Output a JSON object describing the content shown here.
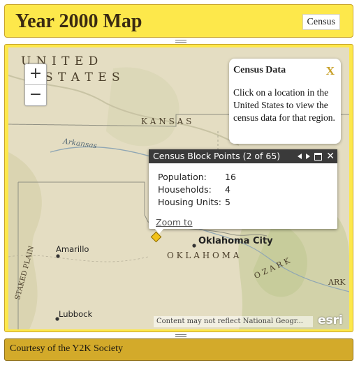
{
  "header": {
    "title": "Year 2000 Map",
    "census_button": "Census"
  },
  "map": {
    "labels": {
      "united": "U N I T E D",
      "states": "S T A T E S",
      "kansas": "K A N S A S",
      "arkansas_river": "Arkansas",
      "amarillo": "Amarillo",
      "oklahoma_city": "Oklahoma City",
      "oklahoma": "O K L A H O M A",
      "lubbock": "Lubbock",
      "staked_plain": "STAKED PLAIN",
      "ozark": "O Z A R K",
      "ark": "ARK"
    },
    "zoom_in": "+",
    "zoom_out": "−",
    "attribution": "Content may not reflect National Geogr...",
    "esri_logo": "esri"
  },
  "legend": {
    "title": "Census Data",
    "close": "X",
    "text": "Click on a location in the United States to view the census data for that region."
  },
  "popup": {
    "title": "Census Block Points (2 of 65)",
    "fields": [
      {
        "label": "Population:",
        "value": "16"
      },
      {
        "label": "Households:",
        "value": "4"
      },
      {
        "label": "Housing Units:",
        "value": "5"
      }
    ],
    "zoom_link": "Zoom to"
  },
  "footer": {
    "text": "Courtesy of the Y2K Society"
  },
  "colors": {
    "header_bg": "#fde84b",
    "footer_bg": "#d3aa2a",
    "marker": "#f2c21a"
  }
}
